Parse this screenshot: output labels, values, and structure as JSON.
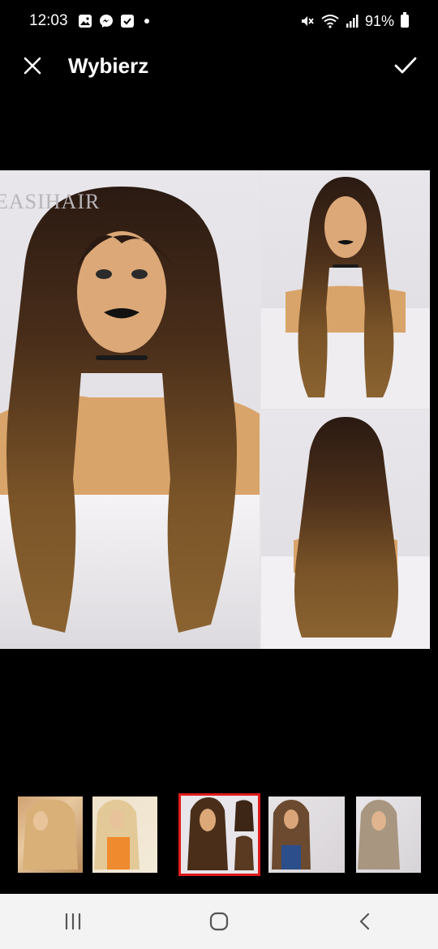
{
  "status_bar": {
    "time": "12:03",
    "battery": "91%",
    "left_icons": [
      "gallery-icon",
      "messenger-icon",
      "check-square-icon",
      "dot-icon"
    ],
    "right_icons": [
      "mute-icon",
      "wifi-icon",
      "signal-icon",
      "battery-icon"
    ]
  },
  "app_bar": {
    "title": "Wybierz",
    "close_icon": "close-icon",
    "confirm_icon": "check-icon"
  },
  "preview": {
    "brand_text": "EASIHAIR"
  },
  "thumbnails": {
    "count": 5,
    "selected_index": 2,
    "accent_color": "#e01b1b"
  },
  "nav_bar": {
    "buttons": [
      "recent-apps-icon",
      "home-icon",
      "back-icon"
    ]
  }
}
